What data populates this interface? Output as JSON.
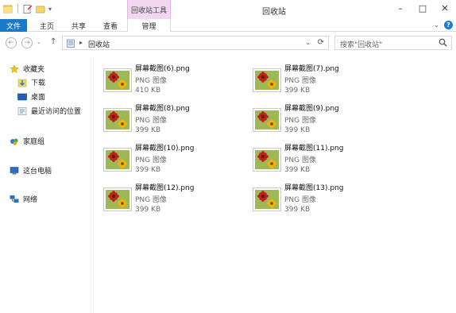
{
  "window": {
    "title": "回收站",
    "context_tab_group": "回收站工具",
    "controls": {
      "minimize": "–",
      "maximize": "□",
      "close": "✕"
    }
  },
  "ribbon": {
    "tabs": [
      {
        "label": "文件"
      },
      {
        "label": "主页"
      },
      {
        "label": "共享"
      },
      {
        "label": "查看"
      },
      {
        "label": "管理"
      }
    ],
    "expand_glyph": "⌄",
    "help_glyph": "?"
  },
  "address": {
    "back_glyph": "←",
    "forward_glyph": "→",
    "history_glyph": "⌄",
    "up_glyph": "↑",
    "path": "回收站",
    "sep_glyph": "▸",
    "dropdown_glyph": "⌄",
    "refresh_glyph": "⟳"
  },
  "search": {
    "placeholder": "搜索\"回收站\""
  },
  "nav": {
    "favorites": "收藏夹",
    "downloads": "下载",
    "desktop": "桌面",
    "recent": "最近访问的位置",
    "homegroup": "家庭组",
    "this_pc": "这台电脑",
    "network": "网络"
  },
  "files": [
    {
      "name": "屏幕截图(6).png",
      "type": "PNG 图像",
      "size": "410 KB"
    },
    {
      "name": "屏幕截图(7).png",
      "type": "PNG 图像",
      "size": "399 KB"
    },
    {
      "name": "屏幕截图(8).png",
      "type": "PNG 图像",
      "size": "399 KB"
    },
    {
      "name": "屏幕截图(9).png",
      "type": "PNG 图像",
      "size": "399 KB"
    },
    {
      "name": "屏幕截图(10).png",
      "type": "PNG 图像",
      "size": "399 KB"
    },
    {
      "name": "屏幕截图(11).png",
      "type": "PNG 图像",
      "size": "399 KB"
    },
    {
      "name": "屏幕截图(12).png",
      "type": "PNG 图像",
      "size": "399 KB"
    },
    {
      "name": "屏幕截图(13).png",
      "type": "PNG 图像",
      "size": "399 KB"
    }
  ],
  "colors": {
    "file_tab": "#1979ca",
    "context_tab": "#f1d7ef",
    "thumb_red": "#c0211a",
    "thumb_yellow": "#f5b400"
  }
}
